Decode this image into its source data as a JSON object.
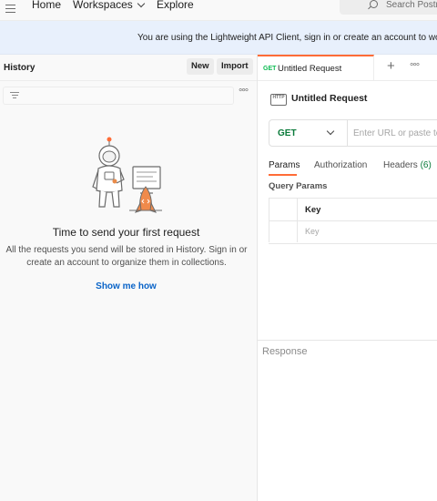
{
  "topbar": {
    "nav": [
      "Home",
      "Workspaces",
      "Explore"
    ],
    "search_placeholder": "Search Postm"
  },
  "banner": {
    "text": "You are using the Lightweight API Client, sign in or create an account to work"
  },
  "history": {
    "title": "History",
    "new_label": "New",
    "import_label": "Import",
    "more_label": "°°°",
    "empty_title": "Time to send your first request",
    "empty_desc_line1": "All the requests you send will be stored in History. Sign in or",
    "empty_desc_line2": "create an account to organize them in collections.",
    "show_me_label": "Show me how"
  },
  "request": {
    "tab_method": "GET",
    "tab_title": "Untitled Request",
    "plus_label": "+",
    "more_label": "°°°",
    "title": "Untitled Request",
    "icon_text": "HTTP",
    "method": "GET",
    "url_placeholder": "Enter URL or paste te",
    "tabs": {
      "params": "Params",
      "authorization": "Authorization",
      "headers": "Headers",
      "headers_count": "(6)"
    },
    "query_params_label": "Query Params",
    "table_header_key": "Key",
    "table_row_key_placeholder": "Key",
    "response_label": "Response"
  },
  "colors": {
    "accent": "#ff6c37",
    "link": "#0a64c8",
    "get_method": "#0a7a3a",
    "banner_bg": "#e8f0fc"
  }
}
